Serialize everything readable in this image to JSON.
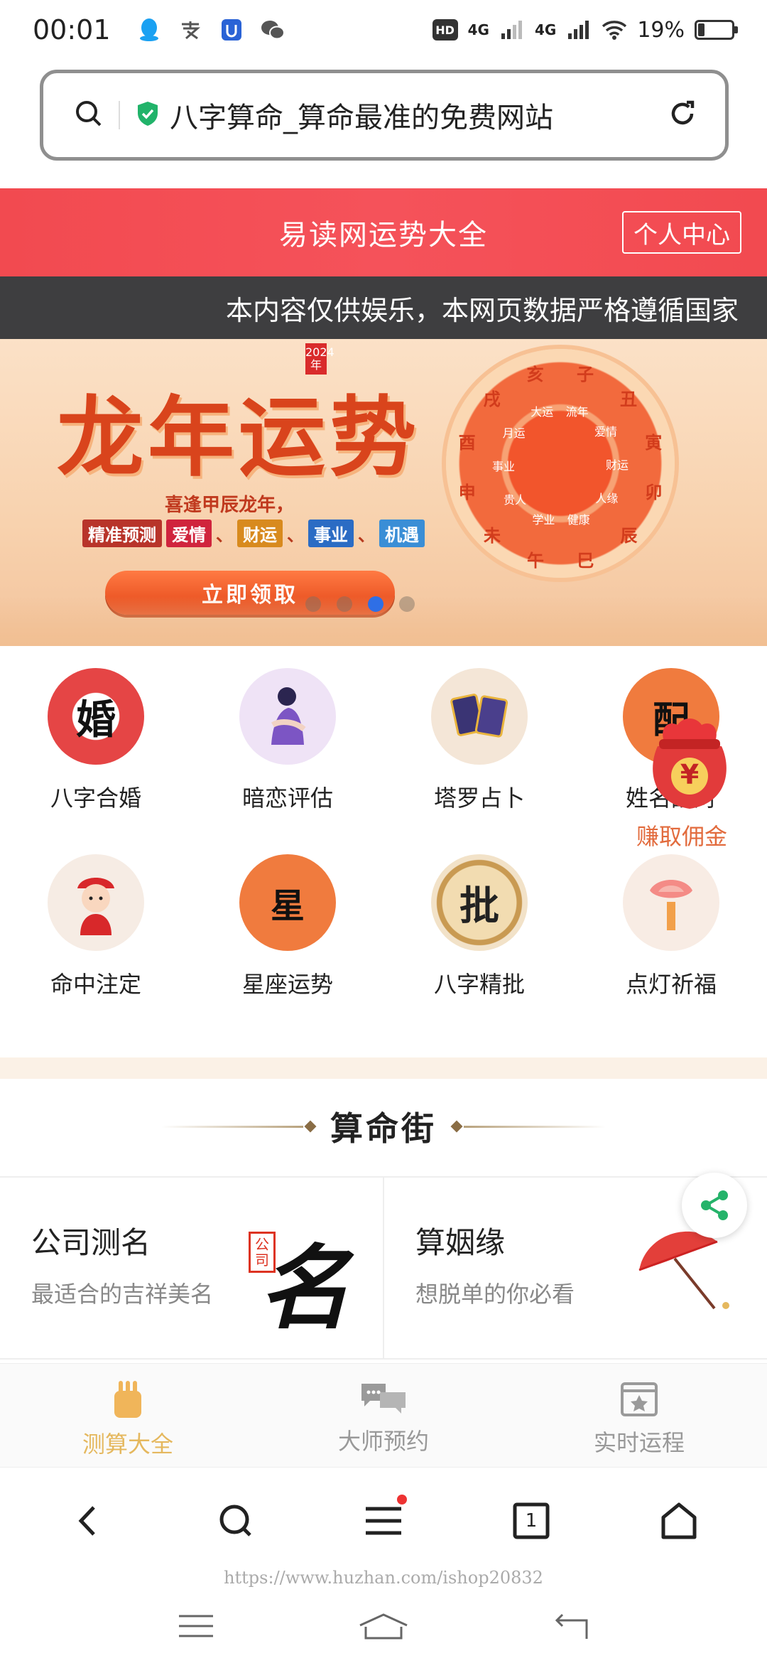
{
  "status_bar": {
    "time": "00:01",
    "network_1": "4G",
    "network_2": "4G",
    "battery_percent": "19%",
    "battery_level": 0.19,
    "hd_label": "HD"
  },
  "url_bar": {
    "page_title": "八字算命_算命最准的免费网站"
  },
  "header": {
    "title": "易读网运势大全",
    "personal_center": "个人中心"
  },
  "notice": {
    "text": "本内容仅供娱乐，本网页数据严格遵循国家"
  },
  "banner": {
    "title": "龙年运势",
    "year_badge": "2024年",
    "subtitle": "喜逢甲辰龙年，",
    "precise_label": "精准预测",
    "tags": [
      "爱情",
      "财运",
      "事业",
      "机遇"
    ],
    "cta": "立即领取",
    "wheel_outer": [
      "子",
      "丑",
      "寅",
      "卯",
      "辰",
      "巳",
      "午",
      "未",
      "申",
      "酉",
      "戌",
      "亥"
    ],
    "wheel_inner": [
      "流年",
      "爱情",
      "财运",
      "人缘",
      "健康",
      "学业",
      "贵人",
      "事业",
      "月运",
      "大运"
    ],
    "slide_count": 4,
    "active_slide": 3
  },
  "services": [
    {
      "label": "八字合婚",
      "glyph": "婚",
      "icon": "marriage-icon"
    },
    {
      "label": "暗恋评估",
      "glyph": "",
      "icon": "crush-icon"
    },
    {
      "label": "塔罗占卜",
      "glyph": "",
      "icon": "tarot-icon"
    },
    {
      "label": "姓名配对",
      "glyph": "配",
      "icon": "name-match-icon"
    },
    {
      "label": "命中注定",
      "glyph": "",
      "icon": "destiny-icon"
    },
    {
      "label": "星座运势",
      "glyph": "星",
      "icon": "horoscope-icon"
    },
    {
      "label": "八字精批",
      "glyph": "批",
      "icon": "bazi-analysis-icon"
    },
    {
      "label": "点灯祈福",
      "glyph": "",
      "icon": "lantern-icon"
    }
  ],
  "red_packet": {
    "symbol": "¥",
    "label": "赚取佣金"
  },
  "section": {
    "title": "算命街"
  },
  "cards": [
    {
      "title": "公司测名",
      "subtitle": "最适合的吉祥美名",
      "art": "名",
      "seal": "公司"
    },
    {
      "title": "算姻缘",
      "subtitle": "想脱单的你必看"
    }
  ],
  "tabs": [
    {
      "label": "测算大全",
      "active": true
    },
    {
      "label": "大师预约",
      "active": false
    },
    {
      "label": "实时运程",
      "active": false
    }
  ],
  "browser_nav": {
    "tab_count": "1"
  },
  "watermark": "https://www.huzhan.com/ishop20832",
  "colors": {
    "header_red": "#f24a50",
    "notice_bg": "#3e3e40",
    "active_tab": "#e5b85e",
    "share_green": "#25b36a",
    "dot_active": "#2f6fe6"
  }
}
